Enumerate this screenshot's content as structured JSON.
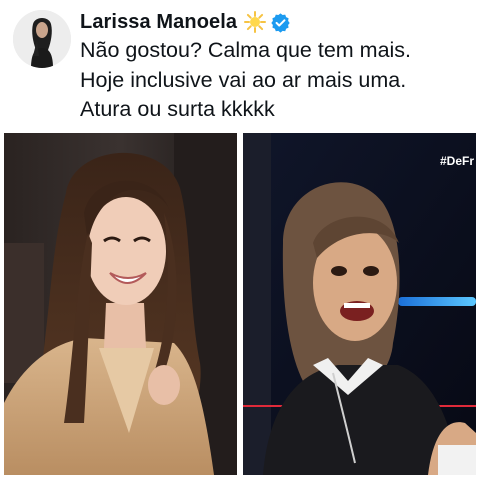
{
  "author": {
    "display_name": "Larissa Manoela",
    "emoji": "sun-icon",
    "verified_badge": "verified-icon",
    "verified_color": "#1d9bf0"
  },
  "tweet": {
    "lines": [
      "Não gostou? Calma que tem mais.",
      "Hoje inclusive vai ao ar mais uma.",
      "Atura ou surta kkkkk"
    ]
  },
  "media": {
    "left_photo": {
      "subject": "smiling-woman-photo"
    },
    "right_photo": {
      "subject": "tv-screenshot-photo",
      "hashtag": "#DeFr"
    }
  },
  "colors": {
    "text": "#0f1419",
    "background": "#ffffff",
    "tv_background": "#0c0f1d",
    "tv_accent_blue": "#3fa9ff",
    "tv_accent_red": "#e02a3a"
  }
}
